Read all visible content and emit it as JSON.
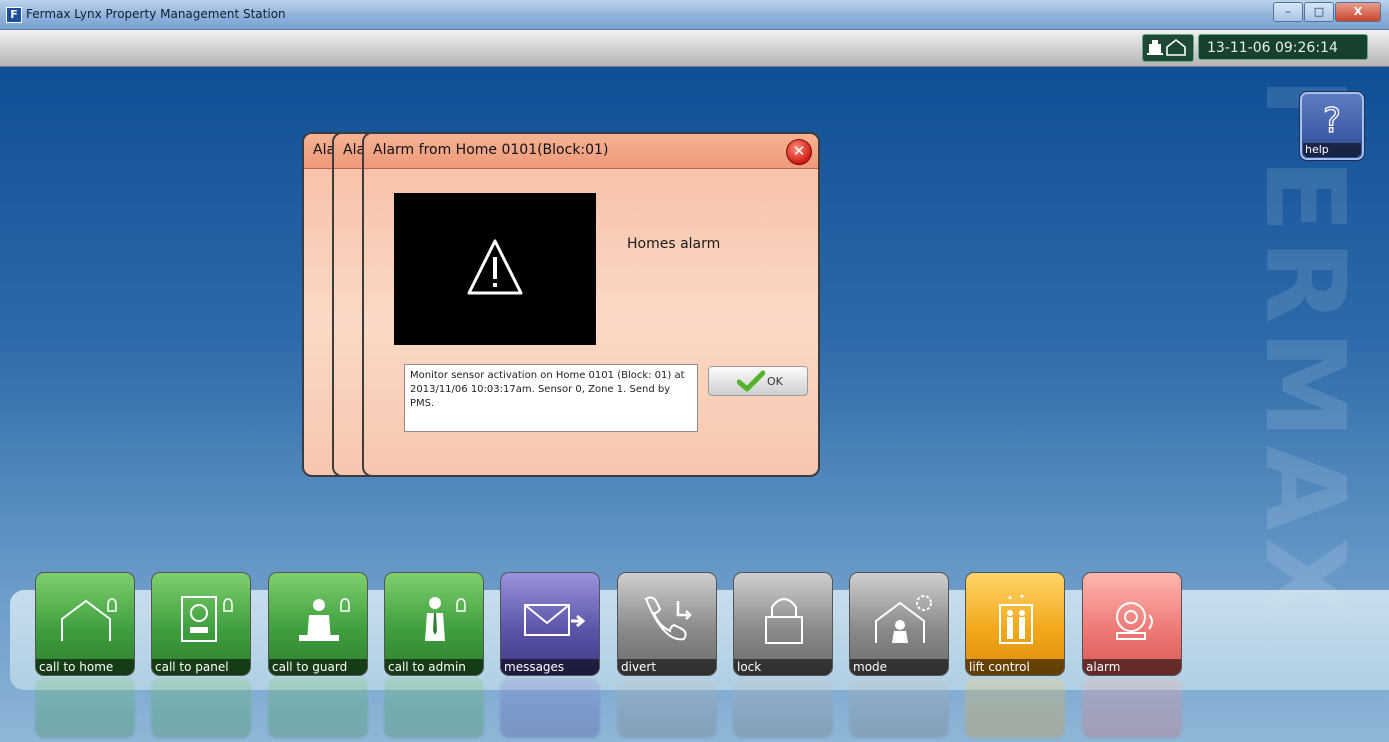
{
  "window": {
    "title": "Fermax Lynx Property Management Station",
    "icon_letter": "F",
    "minimize": "–",
    "maximize": "□",
    "close": "X"
  },
  "status": {
    "datetime": "13-11-06 09:26:14"
  },
  "help": {
    "label": "help",
    "glyph": "?"
  },
  "watermark": "FERMAX",
  "dialog": {
    "back_titles": [
      "Ala",
      "Ala"
    ],
    "title": "Alarm from Home 0101(Block:01)",
    "close_glyph": "✕",
    "alarm_type": "Homes alarm",
    "message": "Monitor sensor activation on Home 0101 (Block: 01) at 2013/11/06 10:03:17am. Sensor 0, Zone 1. Send by PMS.",
    "ok_label": "OK"
  },
  "dock": [
    {
      "label": "call to home",
      "icon": "house-bell-icon",
      "color": "green"
    },
    {
      "label": "call to panel",
      "icon": "panel-bell-icon",
      "color": "green"
    },
    {
      "label": "call to guard",
      "icon": "guard-bell-icon",
      "color": "green"
    },
    {
      "label": "call to admin",
      "icon": "admin-bell-icon",
      "color": "green"
    },
    {
      "label": "messages",
      "icon": "envelope-icon",
      "color": "purple"
    },
    {
      "label": "divert",
      "icon": "phone-divert-icon",
      "color": "gray"
    },
    {
      "label": "lock",
      "icon": "padlock-icon",
      "color": "gray"
    },
    {
      "label": "mode",
      "icon": "house-gear-icon",
      "color": "gray"
    },
    {
      "label": "lift control",
      "icon": "elevator-icon",
      "color": "orange"
    },
    {
      "label": "alarm",
      "icon": "alarm-bell-icon",
      "color": "red"
    }
  ],
  "colors": {
    "green": "#3f9f3f",
    "purple": "#5a55a8",
    "gray": "#8a8a8a",
    "orange": "#f2a81c",
    "red": "#ee7a76"
  }
}
